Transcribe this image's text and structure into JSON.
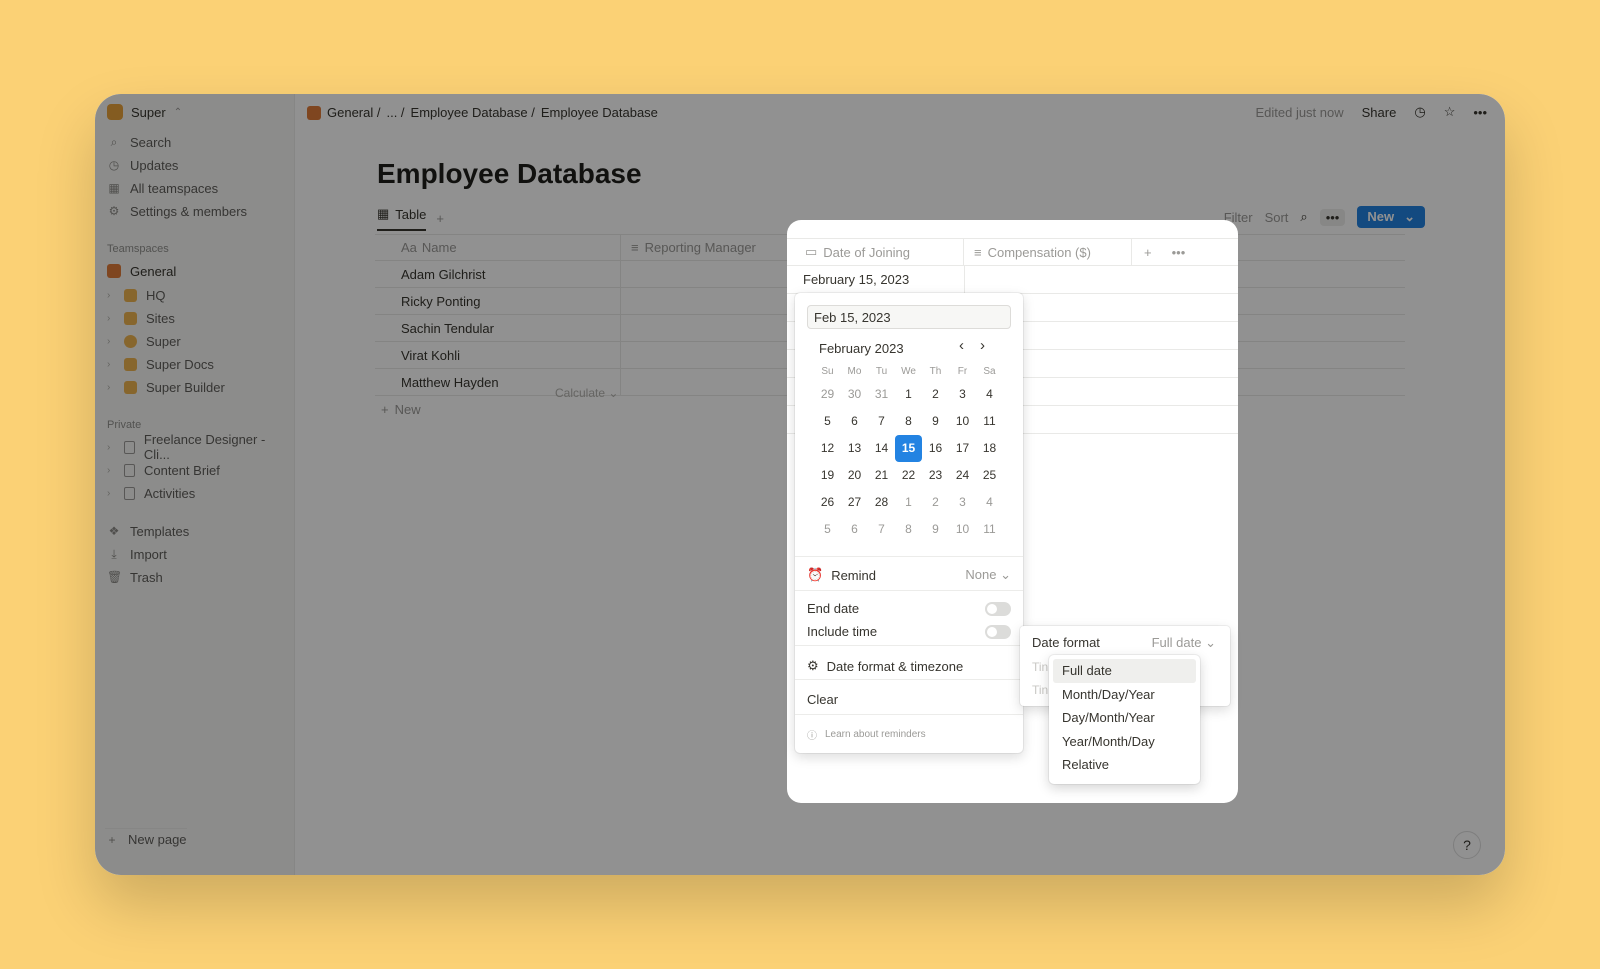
{
  "workspace": {
    "name": "Super",
    "switch_icon": "updown-chevron-icon"
  },
  "sidebar": {
    "nav": [
      {
        "icon": "search-icon",
        "label": "Search"
      },
      {
        "icon": "clock-icon",
        "label": "Updates"
      },
      {
        "icon": "building-icon",
        "label": "All teamspaces"
      },
      {
        "icon": "gear-icon",
        "label": "Settings & members"
      }
    ],
    "teamspaces_header": "Teamspaces",
    "teamspaces": [
      {
        "label": "General"
      },
      {
        "label": "HQ"
      },
      {
        "label": "Sites"
      },
      {
        "label": "Super"
      },
      {
        "label": "Super Docs"
      },
      {
        "label": "Super Builder"
      }
    ],
    "private_header": "Private",
    "private": [
      {
        "label": "Freelance Designer - Cli..."
      },
      {
        "label": "Content Brief"
      },
      {
        "label": "Activities"
      }
    ],
    "bottom": [
      {
        "icon": "templates-icon",
        "label": "Templates"
      },
      {
        "icon": "download-icon",
        "label": "Import"
      },
      {
        "icon": "trash-icon",
        "label": "Trash"
      }
    ],
    "new_page": "New page"
  },
  "topbar": {
    "crumbs": [
      "General /",
      "... /",
      "Employee Database /",
      "Employee Database"
    ],
    "edited": "Edited just now",
    "share": "Share"
  },
  "page": {
    "title": "Employee Database",
    "view_tab": "Table",
    "toolbar": {
      "filter": "Filter",
      "sort": "Sort",
      "new": "New"
    },
    "columns": [
      "Name",
      "Reporting Manager",
      "Date of Joining",
      "Compensation ($)"
    ],
    "name_prefix": "Aa",
    "rows": [
      "Adam Gilchrist",
      "Ricky Ponting",
      "Sachin Tendular",
      "Virat Kohli",
      "Matthew Hayden"
    ],
    "new_row": "New",
    "calculate": "Calculate"
  },
  "cell_value": "February 15, 2023",
  "date_picker": {
    "input_value": "Feb 15, 2023",
    "month": "February 2023",
    "weekdays": [
      "Su",
      "Mo",
      "Tu",
      "We",
      "Th",
      "Fr",
      "Sa"
    ],
    "weeks": [
      [
        "29",
        "30",
        "31",
        "1",
        "2",
        "3",
        "4"
      ],
      [
        "5",
        "6",
        "7",
        "8",
        "9",
        "10",
        "11"
      ],
      [
        "12",
        "13",
        "14",
        "15",
        "16",
        "17",
        "18"
      ],
      [
        "19",
        "20",
        "21",
        "22",
        "23",
        "24",
        "25"
      ],
      [
        "26",
        "27",
        "28",
        "1",
        "2",
        "3",
        "4"
      ],
      [
        "5",
        "6",
        "7",
        "8",
        "9",
        "10",
        "11"
      ]
    ],
    "selected_day": "15",
    "remind_label": "Remind",
    "remind_value": "None",
    "end_date": "End date",
    "include_time": "Include time",
    "format_timezone": "Date format & timezone",
    "clear": "Clear",
    "learn": "Learn about reminders"
  },
  "format_menu": {
    "label": "Date format",
    "value": "Full date",
    "ghost1": "Tin",
    "ghost2": "Tin",
    "options": [
      "Full date",
      "Month/Day/Year",
      "Day/Month/Year",
      "Year/Month/Day",
      "Relative"
    ]
  },
  "help": "?",
  "colors": {
    "background": "#fbd175",
    "accent": "#2383e2",
    "overlay": "rgba(0,0,0,0.43)"
  }
}
